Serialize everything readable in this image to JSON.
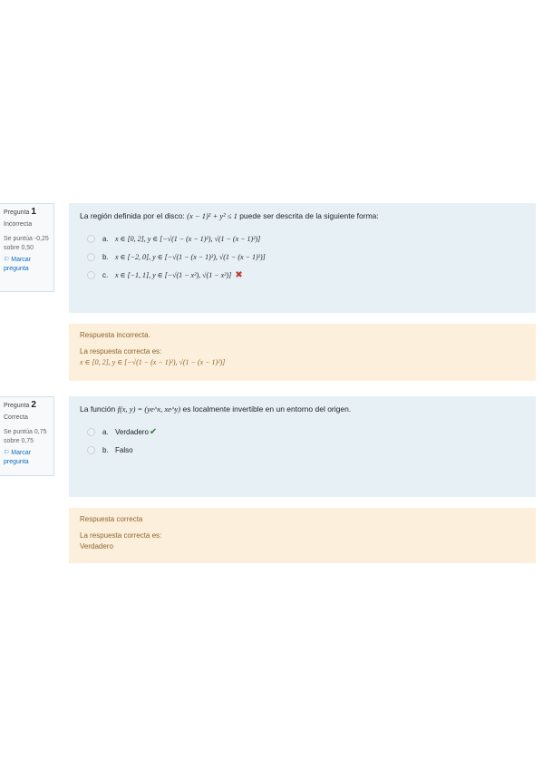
{
  "questions": [
    {
      "number_label": "Pregunta",
      "number": "1",
      "state": "Incorrecta",
      "grade": "Se puntúa -0,25 sobre 0,50",
      "flag_label": "Marcar pregunta",
      "text_before": "La región definida por el disco: ",
      "formula": "(x − 1)² + y² ≤ 1",
      "text_after": " puede ser descrita de la siguiente forma:",
      "options": [
        {
          "letter": "a.",
          "text": "x ∈ [0, 2],  y ∈ [−√(1 − (x − 1)²), √(1 − (x − 1)²)]"
        },
        {
          "letter": "b.",
          "text": "x ∈ [−2, 0],  y ∈ [−√(1 − (x − 1)²), √(1 − (x − 1)²)]"
        },
        {
          "letter": "c.",
          "text": "x ∈ [−1, 1],  y ∈ [−√(1 − x²), √(1 − x²)]"
        }
      ],
      "feedback": "Respuesta incorrecta.",
      "right_answer_label": "La respuesta correcta es:",
      "right_answer": "x ∈ [0, 2],  y ∈ [−√(1 − (x − 1)²), √(1 − (x − 1)²)]"
    },
    {
      "number_label": "Pregunta",
      "number": "2",
      "state": "Correcta",
      "grade": "Se puntúa 0,75 sobre 0,75",
      "flag_label": "Marcar pregunta",
      "text_before": "La función ",
      "formula": "f(x, y) = (ye^x, xe^y)",
      "text_after": " es localmente invertible en un entorno del origen.",
      "options": [
        {
          "letter": "a.",
          "text": "Verdadero"
        },
        {
          "letter": "b.",
          "text": "Falso"
        }
      ],
      "feedback": "Respuesta correcta",
      "right_answer_label": "La respuesta correcta es:",
      "right_answer": "Verdadero"
    }
  ]
}
